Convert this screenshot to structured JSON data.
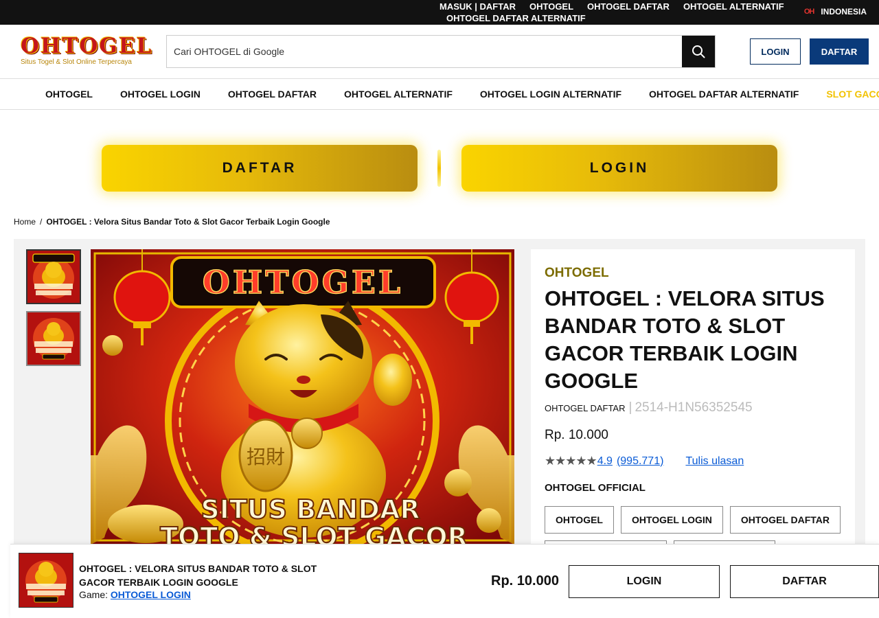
{
  "topbar": {
    "links_row1": [
      "MASUK | DAFTAR",
      "OHTOGEL",
      "OHTOGEL DAFTAR",
      "OHTOGEL ALTERNATIF"
    ],
    "link_row2": "OHTOGEL DAFTAR ALTERNATIF",
    "lang_flag": "OH",
    "language": "INDONESIA"
  },
  "header": {
    "logo_word": "OHTOGEL",
    "logo_tagline": "Situs Togel & Slot Online Terpercaya",
    "search_placeholder": "Cari OHTOGEL di Google",
    "login_label": "LOGIN",
    "daftar_label": "DAFTAR"
  },
  "nav": {
    "items": [
      "OHTOGEL",
      "OHTOGEL LOGIN",
      "OHTOGEL DAFTAR",
      "OHTOGEL ALTERNATIF",
      "OHTOGEL LOGIN ALTERNATIF",
      "OHTOGEL DAFTAR ALTERNATIF",
      "SLOT GACOR"
    ]
  },
  "cta": {
    "daftar": "DAFTAR",
    "login": "LOGIN"
  },
  "breadcrumb": {
    "home": "Home",
    "separator": "/",
    "current": "OHTOGEL : Velora Situs Bandar Toto & Slot Gacor Terbaik Login Google"
  },
  "banner": {
    "brand": "OHTOGEL",
    "line1": "SITUS BANDAR",
    "line2": "TOTO & SLOT GACOR",
    "coin_char": "招財"
  },
  "product": {
    "brand": "OHTOGEL",
    "title": "OHTOGEL : VELORA SITUS BANDAR TOTO & SLOT GACOR TERBAIK LOGIN GOOGLE",
    "seller": "OHTOGEL DAFTAR",
    "separator": "|",
    "sku": "2514-H1N56352545",
    "price": "Rp. 10.000",
    "stars": "★★★★★",
    "rating": "4.9",
    "rating_count": "(995.771)",
    "review_link": "Tulis ulasan",
    "official_label": "OHTOGEL OFFICIAL",
    "chips": [
      "OHTOGEL",
      "OHTOGEL LOGIN",
      "OHTOGEL DAFTAR"
    ]
  },
  "sticky": {
    "title": "OHTOGEL : VELORA SITUS BANDAR TOTO & SLOT GACOR TERBAIK LOGIN GOOGLE",
    "game_label": "Game:",
    "game_link": "OHTOGEL LOGIN",
    "price": "Rp. 10.000",
    "login_label": "LOGIN",
    "daftar_label": "DAFTAR"
  },
  "colors": {
    "topbar_bg": "#121212",
    "daftar_blue": "#0a3a7a",
    "gold": "#f2c200",
    "brand_olive": "#7c6c00",
    "link_blue": "#0a5bd6",
    "banner_red": "#c4161c"
  },
  "icons": {
    "search": "search-icon",
    "flag": "flag-icon"
  }
}
